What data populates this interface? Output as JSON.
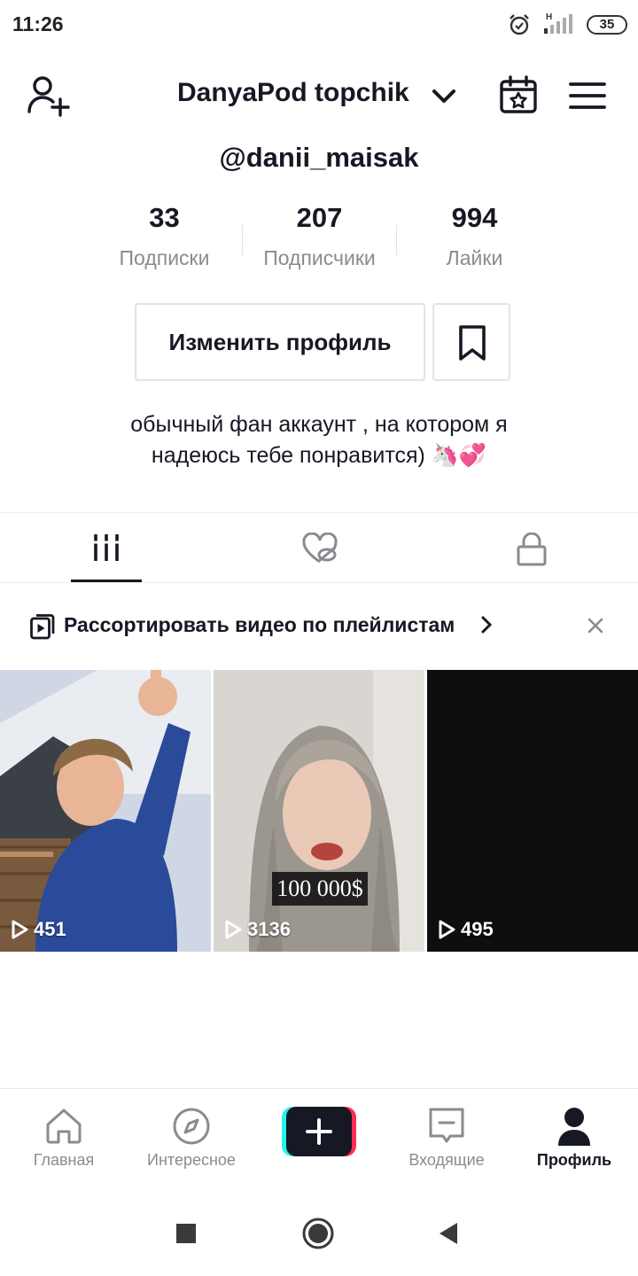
{
  "status_bar": {
    "time": "11:26",
    "network": "H",
    "battery": "35"
  },
  "header": {
    "title": "DanyaPod topchik",
    "handle": "@danii_maisak"
  },
  "stats": [
    {
      "value": "33",
      "label": "Подписки"
    },
    {
      "value": "207",
      "label": "Подписчики"
    },
    {
      "value": "994",
      "label": "Лайки"
    }
  ],
  "actions": {
    "edit_label": "Изменить профиль"
  },
  "bio": {
    "line1": "обычный фан аккаунт , на котором я",
    "line2": "надеюсь тебе понравится) 🦄💞"
  },
  "tabs": [
    {
      "icon": "grid-icon",
      "active": true
    },
    {
      "icon": "liked-hidden-icon",
      "active": false
    },
    {
      "icon": "lock-icon",
      "active": false
    }
  ],
  "playlist_banner": {
    "text": "Рассортировать видео по плейлистам"
  },
  "videos": [
    {
      "views": "451"
    },
    {
      "views": "3136",
      "caption": "100 000$"
    },
    {
      "views": "495"
    }
  ],
  "nav": [
    {
      "label": "Главная",
      "icon": "home-icon"
    },
    {
      "label": "Интересное",
      "icon": "compass-icon"
    },
    {
      "label": "",
      "icon": "plus-icon"
    },
    {
      "label": "Входящие",
      "icon": "inbox-icon"
    },
    {
      "label": "Профиль",
      "icon": "profile-icon",
      "active": true
    }
  ],
  "colors": {
    "text": "#161823",
    "muted": "#8a8b91",
    "border": "#e3e3e4",
    "cyan": "#25f4ee",
    "red": "#fe2c55"
  }
}
